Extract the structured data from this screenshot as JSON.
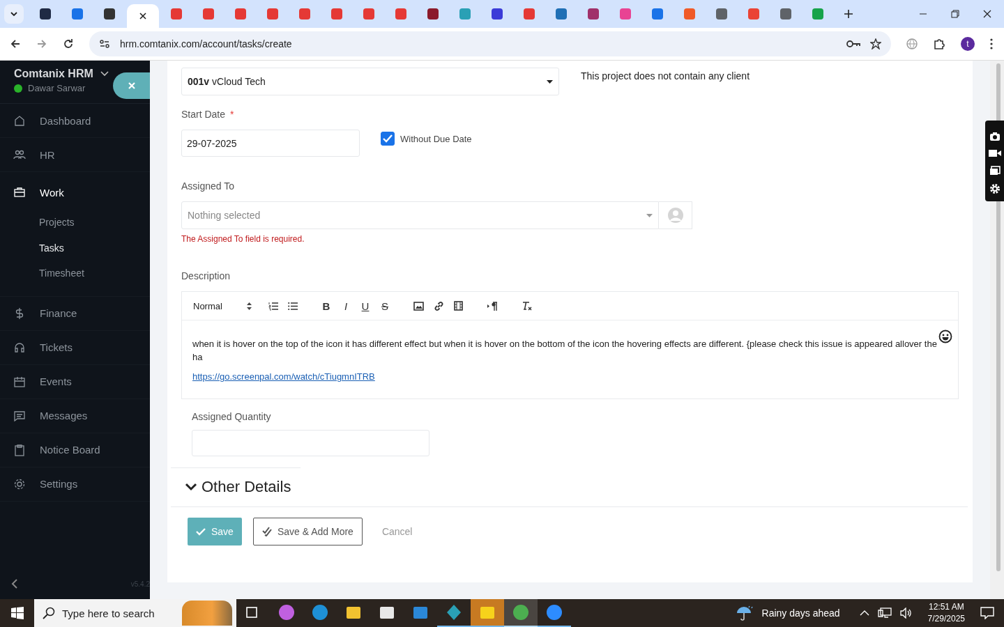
{
  "browser": {
    "tabs": [
      {
        "selected": false,
        "color": "#1f2a44"
      },
      {
        "selected": false,
        "color": "#1a73e8"
      },
      {
        "selected": false,
        "color": "#333333"
      },
      {
        "selected": true
      },
      {
        "selected": false,
        "color": "#e53935"
      },
      {
        "selected": false,
        "color": "#e53935"
      },
      {
        "selected": false,
        "color": "#e53935"
      },
      {
        "selected": false,
        "color": "#e53935"
      },
      {
        "selected": false,
        "color": "#e53935"
      },
      {
        "selected": false,
        "color": "#e53935"
      },
      {
        "selected": false,
        "color": "#e53935"
      },
      {
        "selected": false,
        "color": "#e53935"
      },
      {
        "selected": false,
        "color": "#8b1a2b"
      },
      {
        "selected": false,
        "color": "#2aa0b5"
      },
      {
        "selected": false,
        "color": "#3b3bd8"
      },
      {
        "selected": false,
        "color": "#e53935"
      },
      {
        "selected": false,
        "color": "#1f6fb5"
      },
      {
        "selected": false,
        "color": "#a0306a"
      },
      {
        "selected": false,
        "color": "#e84393"
      },
      {
        "selected": false,
        "color": "#1a73e8"
      },
      {
        "selected": false,
        "color": "#f05a28"
      },
      {
        "selected": false,
        "color": "#5f6368"
      },
      {
        "selected": false,
        "color": "#ea4335"
      },
      {
        "selected": false,
        "color": "#5f6368"
      },
      {
        "selected": false,
        "color": "#16a34a"
      }
    ],
    "url": "hrm.comtanix.com/account/tasks/create",
    "profile_initial": "t"
  },
  "sidebar": {
    "brand": "Comtanix HRM",
    "user": "Dawar Sarwar",
    "online": true,
    "items": [
      {
        "label": "Dashboard",
        "expanded": false,
        "selected": false
      },
      {
        "label": "HR",
        "expanded": false,
        "selected": false
      },
      {
        "label": "Work",
        "expanded": true,
        "selected": false,
        "children": [
          {
            "label": "Projects",
            "selected": false
          },
          {
            "label": "Tasks",
            "selected": true
          },
          {
            "label": "Timesheet",
            "selected": false
          }
        ]
      },
      {
        "label": "Finance",
        "expanded": false,
        "selected": false
      },
      {
        "label": "Tickets",
        "expanded": false,
        "selected": false
      },
      {
        "label": "Events",
        "expanded": false,
        "selected": false
      },
      {
        "label": "Messages",
        "expanded": false,
        "selected": false
      },
      {
        "label": "Notice Board",
        "expanded": false,
        "selected": false
      },
      {
        "label": "Settings",
        "expanded": false,
        "selected": false
      }
    ],
    "version": "v5.4.2"
  },
  "form": {
    "project": {
      "value": "**001v** vCloud Tech",
      "note": "This project does not contain any client"
    },
    "start_date": {
      "label": "Start Date",
      "required_mark": "*",
      "value": "29-07-2025"
    },
    "without_due_date": {
      "label": "Without Due Date",
      "checked": true
    },
    "assigned_to": {
      "label": "Assigned To",
      "placeholder": "Nothing selected",
      "error": "The Assigned To field is required."
    },
    "description": {
      "label": "Description",
      "format": "Normal",
      "format_buttons": [
        {
          "label": "B",
          "kind": "bold"
        },
        {
          "label": "I",
          "kind": "italic"
        },
        {
          "label": "U",
          "kind": "underline"
        },
        {
          "label": "S",
          "kind": "strike"
        }
      ],
      "text": "when it is hover on the top of the icon it has different effect but when it is hover on the bottom of the icon the hovering effects are different. {please check this issue is appeared allover the ha",
      "link": "https://go.screenpal.com/watch/cTiugmnITRB"
    },
    "assigned_quantity": {
      "label": "Assigned Quantity"
    },
    "other_details": {
      "label": "Other Details"
    },
    "buttons": [
      {
        "label": "Save",
        "kind": "primary"
      },
      {
        "label": "Save & Add More",
        "kind": "outline"
      },
      {
        "label": "Cancel",
        "kind": "link"
      }
    ]
  },
  "taskbar": {
    "search_placeholder": "Type here to search",
    "apps": [
      {
        "running": false,
        "selected": false,
        "attention": false
      },
      {
        "running": false,
        "selected": false,
        "attention": false
      },
      {
        "running": false,
        "selected": false,
        "attention": false
      },
      {
        "running": false,
        "selected": false,
        "attention": false
      },
      {
        "running": false,
        "selected": false,
        "attention": false
      },
      {
        "running": false,
        "selected": false,
        "attention": false
      },
      {
        "running": true,
        "selected": false,
        "attention": false
      },
      {
        "running": true,
        "selected": false,
        "attention": true
      },
      {
        "running": true,
        "selected": true,
        "attention": false
      },
      {
        "running": true,
        "selected": false,
        "attention": false
      }
    ],
    "weather": "Rainy days ahead",
    "time": "12:51 AM",
    "date": "7/29/2025"
  }
}
